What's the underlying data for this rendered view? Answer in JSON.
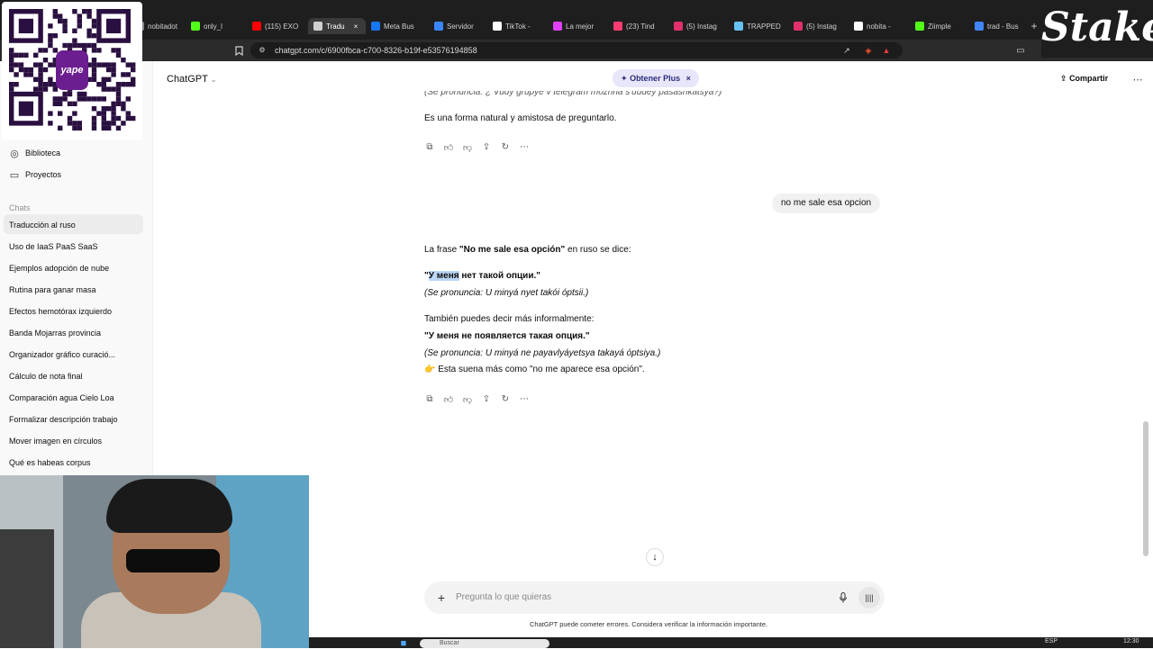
{
  "browser": {
    "tabs": [
      {
        "label": "nobitadot",
        "color": "#888"
      },
      {
        "label": "only_l",
        "color": "#53fc18"
      },
      {
        "label": "(115) EXO",
        "color": "#ff0000"
      },
      {
        "label": "Tradu",
        "color": "#cfcfcf"
      },
      {
        "label": "Meta Bus",
        "color": "#1877f2"
      },
      {
        "label": "Servidor",
        "color": "#3a86ff"
      },
      {
        "label": "TikTok -",
        "color": "#ffffff"
      },
      {
        "label": "La mejor",
        "color": "#e040fb"
      },
      {
        "label": "(23) Tind",
        "color": "#fe3c72"
      },
      {
        "label": "(5) Instag",
        "color": "#e1306c"
      },
      {
        "label": "TRAPPED",
        "color": "#66c0f4"
      },
      {
        "label": "(5) Instag",
        "color": "#e1306c"
      },
      {
        "label": "nobita -",
        "color": "#ffffff"
      },
      {
        "label": "Ziimple",
        "color": "#53fc18"
      },
      {
        "label": "trad - Bus",
        "color": "#4285f4"
      }
    ],
    "url": "chatgpt.com/c/6900fbca-c700-8326-b19f-e53576194858"
  },
  "sidebar": {
    "top_items": [
      "Biblioteca",
      "Proyectos"
    ],
    "chats_heading": "Chats",
    "chats": [
      "Traducción al ruso",
      "Uso de IaaS PaaS SaaS",
      "Ejemplos adopción de nube",
      "Rutina para ganar masa",
      "Efectos hemotórax izquierdo",
      "Banda Mojarras provincia",
      "Organizador gráfico curació...",
      "Cálculo de nota final",
      "Comparación agua Cielo Loa",
      "Formalizar descripción trabajo",
      "Mover imagen en círculos",
      "Qué es habeas corpus"
    ]
  },
  "header": {
    "model": "ChatGPT",
    "plus": "Obtener Plus",
    "share": "Compartir"
  },
  "conversation": {
    "cut_line": "(Se pronuncia: ¿ Vudy grupye v telegram mozhna s'uudey pasashkatsya?)",
    "prev_answer": "Es una forma natural y amistosa de preguntarlo.",
    "user_message": "no me sale esa opcion",
    "answer": {
      "intro_a": "La frase ",
      "intro_b": "\"No me sale esa opción\"",
      "intro_c": " en ruso se dice:",
      "ru1_quote_open": "\"",
      "ru1_highlight": "У меня",
      "ru1_rest": " нет такой опции.\"",
      "pron1": "(Se pronuncia: U minyá nyet takói óptsii.)",
      "informal": "También puedes decir más informalmente:",
      "ru2": "\"У меня не появляется такая опция.\"",
      "pron2": "(Se pronuncia: U minyá ne payavlyáyetsya takayá óptsiya.)",
      "note_emoji": "👉",
      "note": "Esta suena más como \"no me aparece esa opción\"."
    }
  },
  "composer": {
    "placeholder": "Pregunta lo que quieras"
  },
  "footer": "ChatGPT puede cometer errores. Considera verificar la información importante.",
  "overlay": {
    "stake": "Stake",
    "qr_brand": "yape"
  },
  "taskbar": {
    "search": "Buscar",
    "lang": "ESP",
    "time": "12:30"
  }
}
